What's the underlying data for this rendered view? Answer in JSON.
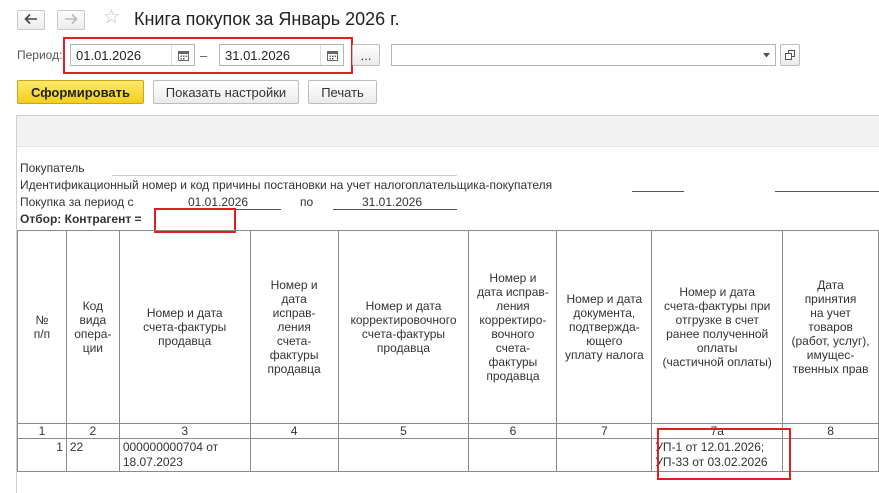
{
  "window": {
    "title": "Книга покупок за Январь 2026 г."
  },
  "period": {
    "label": "Период:",
    "date_from": "01.01.2026",
    "separator": "–",
    "date_to": "31.01.2026",
    "more_label": "..."
  },
  "toolbar": {
    "generate_label": "Сформировать",
    "settings_label": "Показать настройки",
    "print_label": "Печать"
  },
  "report": {
    "buyer_label": "Покупатель",
    "inn_label": "Идентификационный номер и код причины постановки на учет налогоплательщика-покупателя",
    "purchase_period_label": "Покупка за период с",
    "purchase_from": "01.01.2026",
    "purchase_to_label": "по",
    "purchase_to": "31.01.2026",
    "filter_label": "Отбор: Контрагент =",
    "columns": [
      "№\nп/п",
      "Код\nвида\nопера-\nции",
      "Номер и дата\nсчета-фактуры\nпродавца",
      "Номер и\nдата\nисправ-\nления\nсчета-\nфактуры\nпродавца",
      "Номер и дата\nкорректировочного\nсчета-фактуры\nпродавца",
      "Номер и\nдата исправ-\nления\nкорректиро-\nвочного\nсчета-\nфактуры\nпродавца",
      "Номер и дата\nдокумента,\nподтвержда-\nющего\nуплату налога",
      "Номер и дата\nсчета-фактуры при\nотгрузке в счет\nранее полученной\nоплаты\n(частичной оплаты)",
      "Дата\nпринятия\nна учет\nтоваров\n(работ, услуг),\nимущес-\nтвенных прав"
    ],
    "column_numbers": [
      "1",
      "2",
      "3",
      "4",
      "5",
      "6",
      "7",
      "7а",
      "8"
    ],
    "rows": [
      {
        "num": "1",
        "op_code": "22",
        "invoice": "000000000704 от\n18.07.2023",
        "correction": "",
        "adj_invoice": "",
        "adj_correction": "",
        "payment_doc": "",
        "advance_invoice": "УП-1 от 12.01.2026;\nУП-33 от 03.02.2026",
        "accept_date": ""
      }
    ]
  },
  "colors": {
    "highlight": "#e0201f",
    "primary_button": "#f2cf1d"
  }
}
